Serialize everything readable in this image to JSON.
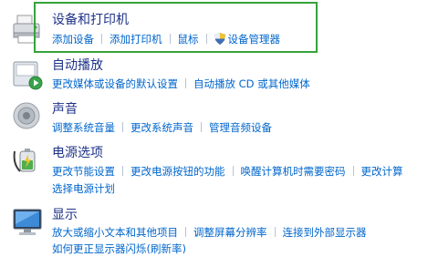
{
  "devices": {
    "title": "设备和打印机",
    "links": [
      "添加设备",
      "添加打印机",
      "鼠标",
      "设备管理器"
    ],
    "icon": "printer-icon"
  },
  "autoplay": {
    "title": "自动播放",
    "links": [
      "更改媒体或设备的默认设置",
      "自动播放 CD 或其他媒体"
    ],
    "icon": "autoplay-icon"
  },
  "sound": {
    "title": "声音",
    "links": [
      "调整系统音量",
      "更改系统声音",
      "管理音频设备"
    ],
    "icon": "speaker-icon"
  },
  "power": {
    "title": "电源选项",
    "links_row1": [
      "更改节能设置",
      "更改电源按钮的功能",
      "唤醒计算机时需要密码",
      "更改计算"
    ],
    "links_row2": [
      "选择电源计划"
    ],
    "icon": "battery-plug-icon"
  },
  "display": {
    "title": "显示",
    "links_row1": [
      "放大或缩小文本和其他项目",
      "调整屏幕分辨率",
      "连接到外部显示器"
    ],
    "links_row2": [
      "如何更正显示器闪烁(刷新率)"
    ],
    "icon": "monitor-icon"
  },
  "colors": {
    "link": "#0066cc",
    "title": "#1e3287",
    "highlight": "#36a33a"
  }
}
